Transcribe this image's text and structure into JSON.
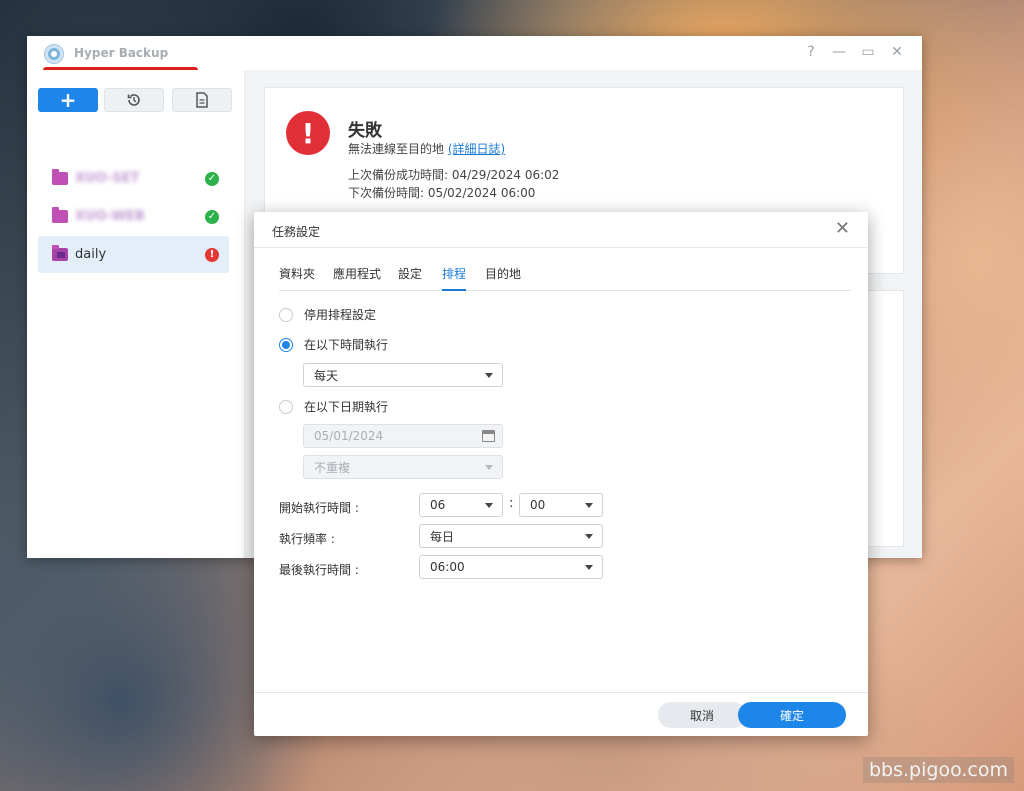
{
  "window": {
    "title": "Hyper Backup",
    "controls": {
      "help": "?",
      "minimize": "—",
      "maximize": "▭",
      "close": "✕"
    }
  },
  "toolbar": {
    "add": "+",
    "restore_icon": "restore-icon",
    "log_icon": "log-icon"
  },
  "tasks": [
    {
      "name": "XUO-SET",
      "status": "ok",
      "blurred": true
    },
    {
      "name": "XUO-WEB",
      "status": "ok",
      "blurred": true
    },
    {
      "name": "daily",
      "status": "error",
      "blurred": false
    }
  ],
  "status_card": {
    "title": "失敗",
    "desc": "無法連線至目的地",
    "link": "(詳細日誌)",
    "last_success": "上次備份成功時間: 04/29/2024 06:02",
    "next_backup": "下次備份時間: 05/02/2024 06:00"
  },
  "dialog": {
    "title": "任務設定",
    "close": "✕",
    "tabs": [
      "資料夾",
      "應用程式",
      "設定",
      "排程",
      "目的地"
    ],
    "active_tab": "排程",
    "options": {
      "disable": "停用排程設定",
      "run_time": "在以下時間執行",
      "run_date": "在以下日期執行"
    },
    "run_time_select": "每天",
    "date_value": "05/01/2024",
    "repeat_select": "不重複",
    "start_label": "開始執行時間 :",
    "start_hour": "06",
    "start_minute": "00",
    "time_separator": ":",
    "freq_label": "執行頻率 :",
    "freq_value": "每日",
    "last_label": "最後執行時間 :",
    "last_value": "06:00",
    "cancel": "取消",
    "ok": "確定"
  },
  "watermark": "bbs.pigoo.com",
  "colors": {
    "accent": "#1d86e8",
    "error": "#e02f36",
    "success": "#2db24a"
  }
}
